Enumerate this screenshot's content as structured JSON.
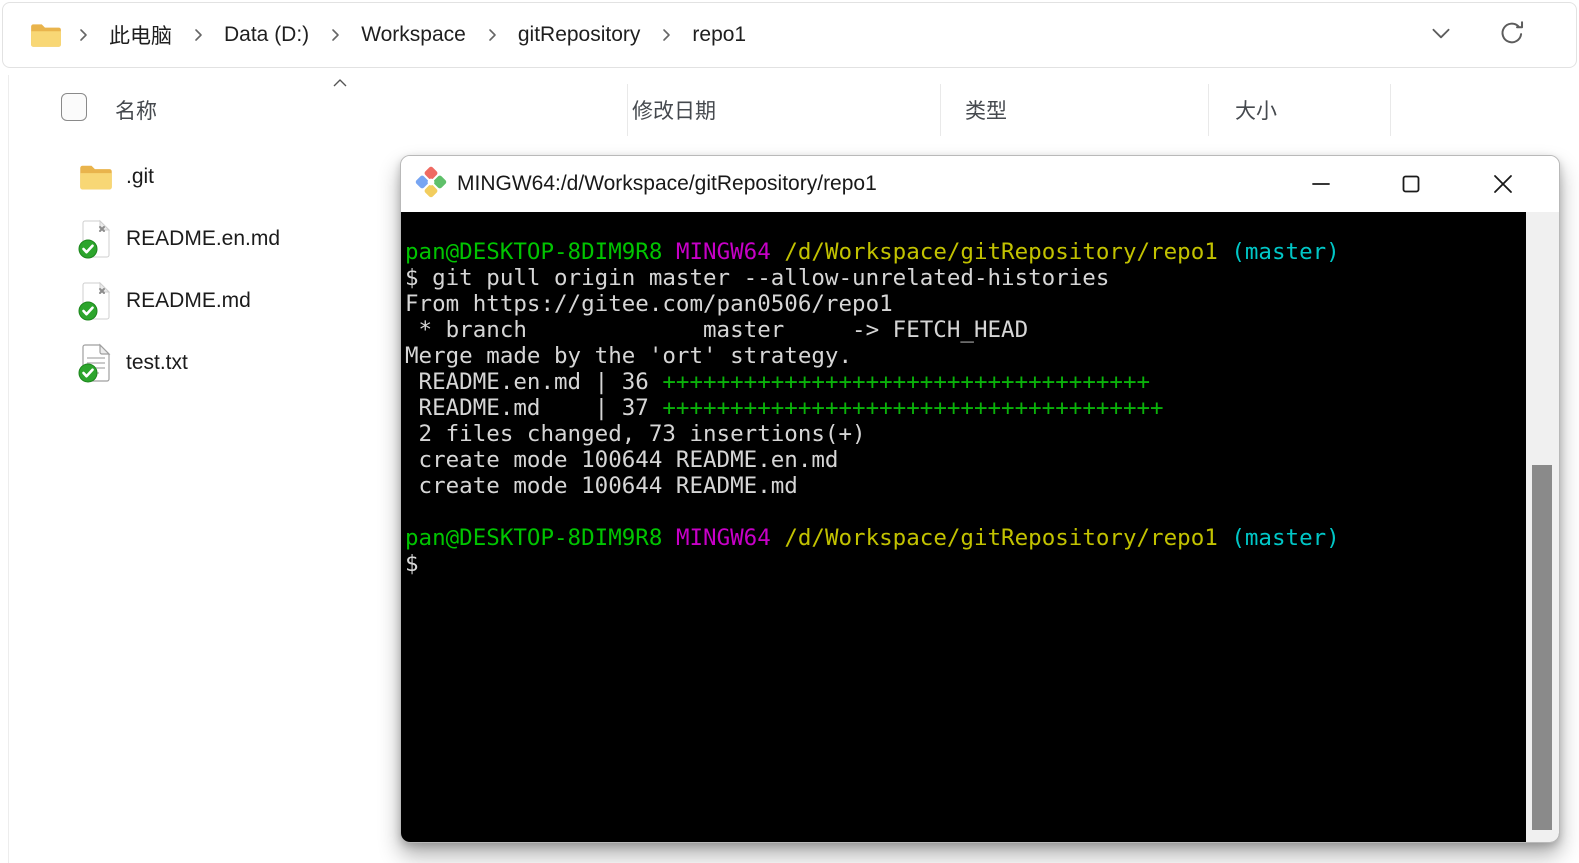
{
  "explorer": {
    "breadcrumb": {
      "items": [
        "此电脑",
        "Data (D:)",
        "Workspace",
        "gitRepository",
        "repo1"
      ]
    },
    "toolbar": {
      "address_dropdown_icon": "chevron-down",
      "refresh_icon": "refresh"
    },
    "columns": {
      "name": "名称",
      "date_modified": "修改日期",
      "type": "类型",
      "size": "大小"
    },
    "files": [
      {
        "name": ".git",
        "icon": "folder-icon"
      },
      {
        "name": "README.en.md",
        "icon": "md-file-checked-icon"
      },
      {
        "name": "README.md",
        "icon": "md-file-checked-icon"
      },
      {
        "name": "test.txt",
        "icon": "txt-file-checked-icon"
      }
    ]
  },
  "terminal": {
    "title": "MINGW64:/d/Workspace/gitRepository/repo1",
    "prompt": {
      "user": "pan@DESKTOP-8DIM9R8 ",
      "app": "MINGW64 ",
      "path": "/d/Workspace/gitRepository/repo1 ",
      "branch": "(master)"
    },
    "lines": {
      "cmd": "$ git pull origin master --allow-unrelated-histories",
      "from": "From https://gitee.com/pan0506/repo1",
      "branch_map": " * branch             master     -> FETCH_HEAD",
      "merge": "Merge made by the 'ort' strategy.",
      "stat1_pre": " README.en.md | 36 ",
      "stat1_plus": "++++++++++++++++++++++++++++++++++++",
      "stat2_pre": " README.md    | 37 ",
      "stat2_plus": "+++++++++++++++++++++++++++++++++++++",
      "summary": " 2 files changed, 73 insertions(+)",
      "create1": " create mode 100644 README.en.md",
      "create2": " create mode 100644 README.md",
      "dollar": "$"
    },
    "colors": {
      "background": "#000000",
      "foreground": "#d6d6d6",
      "green": "#00c400",
      "magenta": "#c700c7",
      "yellow": "#c2c200",
      "cyan": "#00c7c7"
    }
  }
}
